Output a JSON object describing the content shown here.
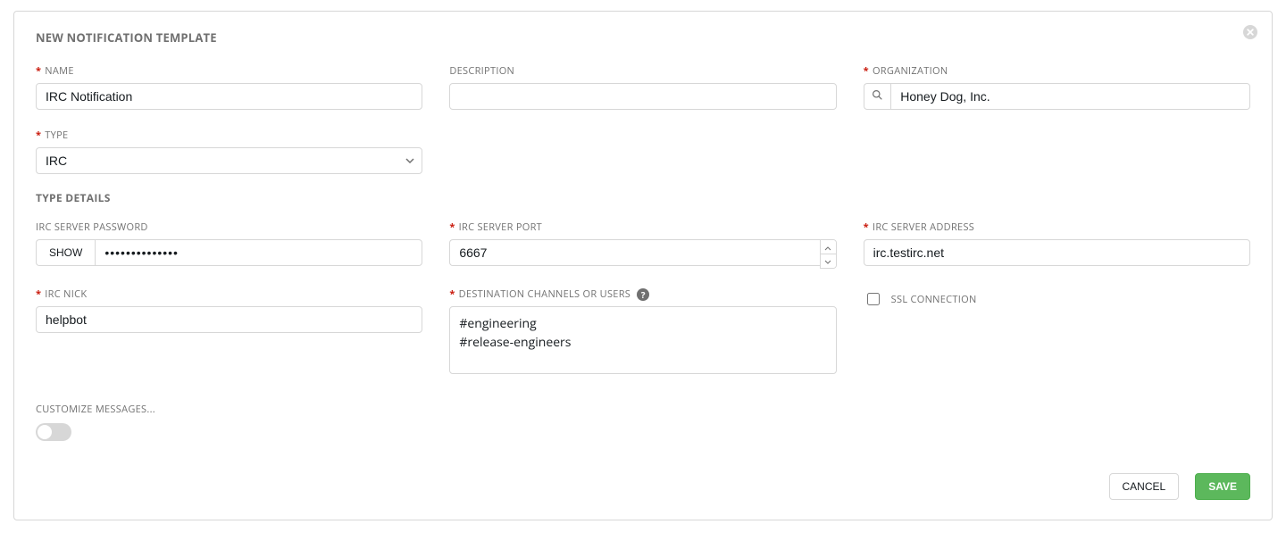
{
  "panel_title": "NEW NOTIFICATION TEMPLATE",
  "labels": {
    "name": "NAME",
    "description": "DESCRIPTION",
    "organization": "ORGANIZATION",
    "type": "TYPE",
    "type_details": "TYPE DETAILS",
    "irc_password": "IRC SERVER PASSWORD",
    "irc_port": "IRC SERVER PORT",
    "irc_address": "IRC SERVER ADDRESS",
    "irc_nick": "IRC NICK",
    "dest_channels": "DESTINATION CHANNELS OR USERS",
    "ssl": "SSL CONNECTION",
    "customize": "CUSTOMIZE MESSAGES...",
    "show": "SHOW"
  },
  "values": {
    "name": "IRC Notification",
    "description": "",
    "organization": "Honey Dog, Inc.",
    "type": "IRC",
    "irc_password_mask": "••••••••••••••",
    "irc_port": "6667",
    "irc_address": "irc.testirc.net",
    "irc_nick": "helpbot",
    "dest_channels": "#engineering\n#release-engineers",
    "ssl_checked": false,
    "customize_on": false
  },
  "buttons": {
    "cancel": "CANCEL",
    "save": "SAVE"
  }
}
